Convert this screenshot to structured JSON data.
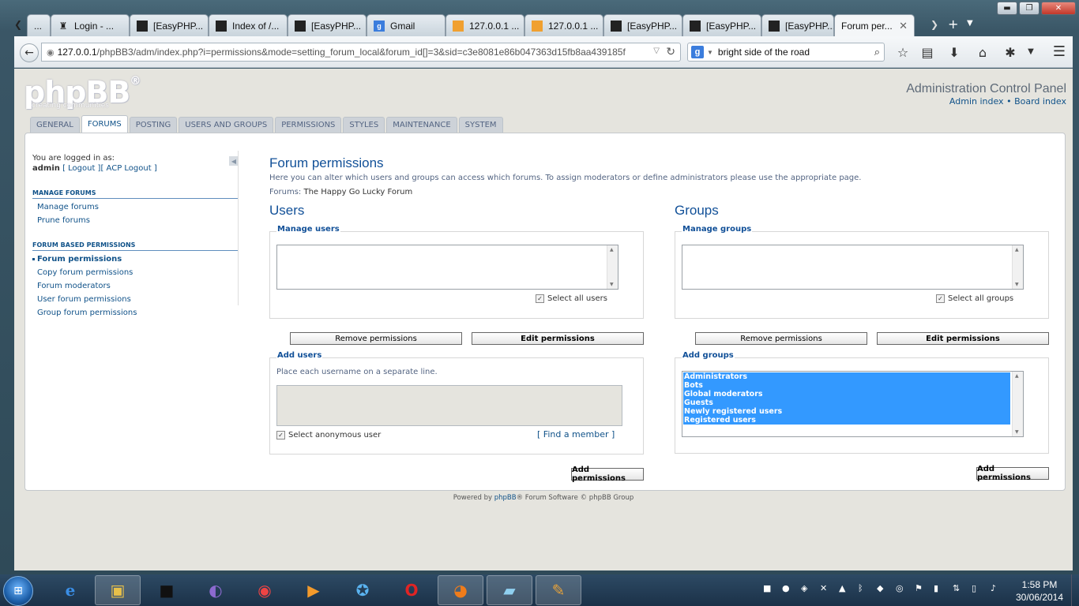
{
  "browser": {
    "tabs": [
      {
        "label": "Login - ...",
        "icon": "user-icon"
      },
      {
        "label": "[EasyPHP...",
        "icon": "easyphp-icon"
      },
      {
        "label": "Index of /...",
        "icon": "easyphp-icon"
      },
      {
        "label": "[EasyPHP...",
        "icon": "easyphp-icon"
      },
      {
        "label": "Gmail",
        "icon": "google-icon"
      },
      {
        "label": "127.0.0.1 ...",
        "icon": "phpmyadmin-icon"
      },
      {
        "label": "127.0.0.1 ...",
        "icon": "phpmyadmin-icon"
      },
      {
        "label": "[EasyPHP...",
        "icon": "easyphp-icon"
      },
      {
        "label": "[EasyPHP...",
        "icon": "easyphp-icon"
      },
      {
        "label": "[EasyPHP...",
        "icon": "easyphp-icon"
      },
      {
        "label": "Forum per...",
        "icon": "phpbb-icon",
        "active": true
      }
    ],
    "first_tab_label": "...",
    "url_host": "127.0.0.1",
    "url_path": "/phpBB3/adm/index.php?i=permissions&mode=setting_forum_local&forum_id[]=3&sid=c3e8081e86b047363d15fb8aa439185f",
    "search_value": "bright side of the road",
    "window_buttons": {
      "minimize": "▬",
      "maximize": "❐",
      "close": "✕"
    }
  },
  "acp": {
    "title": "Administration Control Panel",
    "links": {
      "admin_index": "Admin index",
      "separator": "•",
      "board_index": "Board index"
    },
    "logo_text": "phpBB",
    "logo_reg": "®",
    "logo_sub": "creating communities",
    "tabs": [
      {
        "label": "GENERAL"
      },
      {
        "label": "FORUMS",
        "active": true
      },
      {
        "label": "POSTING"
      },
      {
        "label": "USERS AND GROUPS"
      },
      {
        "label": "PERMISSIONS"
      },
      {
        "label": "STYLES"
      },
      {
        "label": "MAINTENANCE"
      },
      {
        "label": "SYSTEM"
      }
    ]
  },
  "sidebar": {
    "logged_in_as": "You are logged in as:",
    "username": "admin",
    "logout": "[ Logout ]",
    "acp_logout": "[ ACP Logout ]",
    "sections": [
      {
        "heading": "MANAGE FORUMS",
        "items": [
          {
            "label": "Manage forums"
          },
          {
            "label": "Prune forums"
          }
        ]
      },
      {
        "heading": "FORUM BASED PERMISSIONS",
        "items": [
          {
            "label": "Forum permissions",
            "active": true
          },
          {
            "label": "Copy forum permissions"
          },
          {
            "label": "Forum moderators"
          },
          {
            "label": "User forum permissions"
          },
          {
            "label": "Group forum permissions"
          }
        ]
      }
    ]
  },
  "main": {
    "title": "Forum permissions",
    "explain": "Here you can alter which users and groups can access which forums. To assign moderators or define administrators please use the appropriate page.",
    "forums_label": "Forums:",
    "forums_value": "The Happy Go Lucky Forum",
    "users": {
      "heading": "Users",
      "manage_legend": "Manage users",
      "select_all": "Select all users",
      "remove_btn": "Remove permissions",
      "edit_btn": "Edit permissions",
      "add_legend": "Add users",
      "add_explain": "Place each username on a separate line.",
      "anonymous": "Select anonymous user",
      "find_member": "[ Find a member ]",
      "add_btn": "Add permissions"
    },
    "groups": {
      "heading": "Groups",
      "manage_legend": "Manage groups",
      "select_all": "Select all groups",
      "remove_btn": "Remove permissions",
      "edit_btn": "Edit permissions",
      "add_legend": "Add groups",
      "options": [
        "Administrators",
        "Bots",
        "Global moderators",
        "Guests",
        "Newly registered users",
        "Registered users"
      ],
      "add_btn": "Add permissions"
    }
  },
  "footer": {
    "prefix": "Powered by ",
    "phpbb": "phpBB",
    "suffix": "® Forum Software © phpBB Group"
  },
  "taskbar": {
    "time": "1:58 PM",
    "date": "30/06/2014"
  }
}
